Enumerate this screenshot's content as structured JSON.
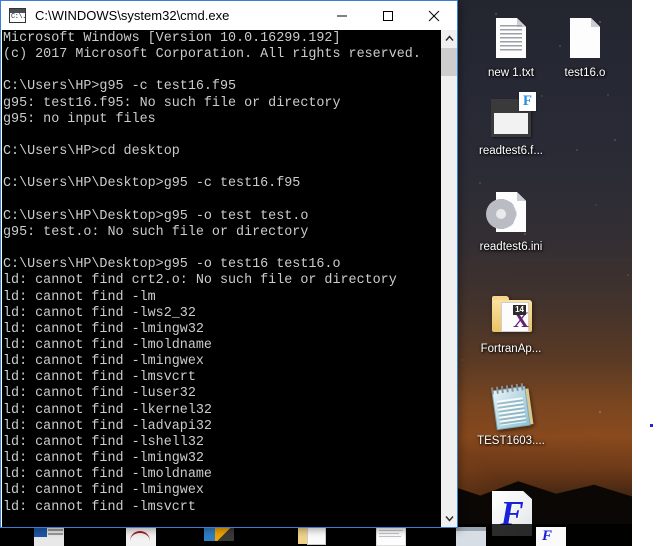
{
  "window": {
    "title": "C:\\WINDOWS\\system32\\cmd.exe",
    "icon": "cmd-icon",
    "icon_text": "C:\\.",
    "controls": {
      "minimize": "minimize-icon",
      "maximize": "maximize-icon",
      "close": "close-icon"
    }
  },
  "console": {
    "lines": [
      "Microsoft Windows [Version 10.0.16299.192]",
      "(c) 2017 Microsoft Corporation. All rights reserved.",
      "",
      "C:\\Users\\HP>g95 -c test16.f95",
      "g95: test16.f95: No such file or directory",
      "g95: no input files",
      "",
      "C:\\Users\\HP>cd desktop",
      "",
      "C:\\Users\\HP\\Desktop>g95 -c test16.f95",
      "",
      "C:\\Users\\HP\\Desktop>g95 -o test test.o",
      "g95: test.o: No such file or directory",
      "",
      "C:\\Users\\HP\\Desktop>g95 -o test16 test16.o",
      "ld: cannot find crt2.o: No such file or directory",
      "ld: cannot find -lm",
      "ld: cannot find -lws2_32",
      "ld: cannot find -lmingw32",
      "ld: cannot find -lmoldname",
      "ld: cannot find -lmingwex",
      "ld: cannot find -lmsvcrt",
      "ld: cannot find -luser32",
      "ld: cannot find -lkernel32",
      "ld: cannot find -ladvapi32",
      "ld: cannot find -lshell32",
      "ld: cannot find -lmingw32",
      "ld: cannot find -lmoldname",
      "ld: cannot find -lmingwex",
      "ld: cannot find -lmsvcrt"
    ],
    "background_color": "#000000",
    "text_color": "#cccccc"
  },
  "scrollbar": {
    "up_arrow": "chevron-up-icon",
    "down_arrow": "chevron-down-icon",
    "thumb": "scrollbar-thumb"
  },
  "desktop": {
    "icons": [
      {
        "label": "new 1.txt",
        "kind": "text-file-icon"
      },
      {
        "label": "test16.o",
        "kind": "blank-file-icon"
      },
      {
        "label": "readtest6.f...",
        "kind": "fortran-source-icon"
      },
      {
        "label": "readtest6.ini",
        "kind": "ini-settings-icon"
      },
      {
        "label": "FortranAp...",
        "kind": "visual-studio-folder-icon"
      },
      {
        "label": "TEST1603....",
        "kind": "notepad-document-icon"
      },
      {
        "label": "",
        "kind": "fortran-app-icon"
      }
    ]
  },
  "taskbar": {
    "items": [
      {
        "name": "taskbar-item-1"
      },
      {
        "name": "taskbar-item-2"
      },
      {
        "name": "taskbar-item-3"
      },
      {
        "name": "taskbar-item-4"
      },
      {
        "name": "taskbar-item-5"
      },
      {
        "name": "taskbar-item-6"
      },
      {
        "name": "taskbar-item-7"
      }
    ]
  }
}
